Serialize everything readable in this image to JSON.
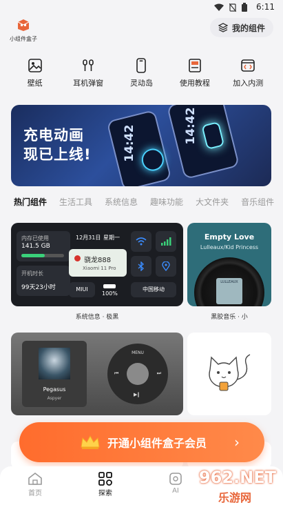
{
  "status": {
    "time": "6:11"
  },
  "header": {
    "logo_text": "小组件盒子",
    "my_widgets": "我的组件"
  },
  "quick_links": [
    {
      "label": "壁纸",
      "icon": "image-icon"
    },
    {
      "label": "耳机弹窗",
      "icon": "earphones-icon"
    },
    {
      "label": "灵动岛",
      "icon": "phone-outline-icon"
    },
    {
      "label": "使用教程",
      "icon": "book-icon"
    },
    {
      "label": "加入内测",
      "icon": "code-window-icon"
    }
  ],
  "banner": {
    "line1": "充电动画",
    "line2": "现已上线!",
    "phone_time": "14:42"
  },
  "tabs": [
    "热门组件",
    "生活工具",
    "系统信息",
    "趣味功能",
    "大文件夹",
    "音乐组件"
  ],
  "cards": {
    "system": {
      "label": "系统信息 · 极黑",
      "storage_title": "内存已使用",
      "storage_value": "141.5 GB",
      "storage_fraction": 0.55,
      "uptime_title": "开机时长",
      "uptime_value": "99天23小时",
      "date": "12月31日",
      "weekday": "星期一",
      "chip": "骁龙888",
      "model": "Xiaomi 11 Pro",
      "os": "MIUI",
      "battery": "100%",
      "carrier": "中国移动"
    },
    "music": {
      "label": "黑胶音乐 · 小",
      "title": "Empty Love",
      "artist": "Lulleaux/Kid Princess",
      "cover_text": "LULLEAUX"
    },
    "ipod": {
      "song": "Pegasus",
      "artist": "Aspyer",
      "menu": "MENU"
    }
  },
  "vip": {
    "label": "开通小组件盒子会员"
  },
  "nav": [
    {
      "label": "首页",
      "icon": "home-icon"
    },
    {
      "label": "探索",
      "icon": "grid-icon"
    },
    {
      "label": "AI",
      "icon": "ai-icon"
    }
  ],
  "watermark": {
    "logo": "962.NET",
    "sub": "乐游网"
  },
  "colors": {
    "accent": "#ff7a3c",
    "banner": "#2c4f9c"
  }
}
